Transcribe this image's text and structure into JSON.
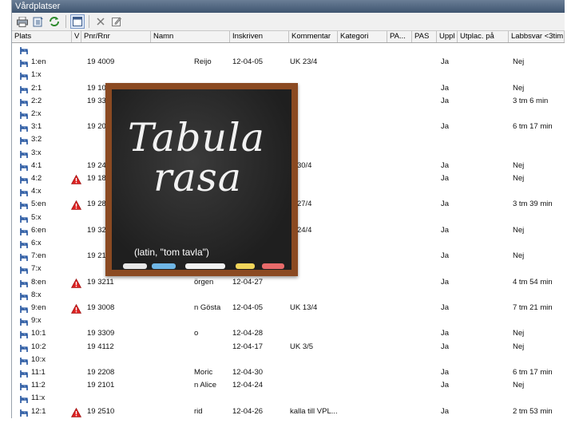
{
  "window": {
    "title": "Vårdplatser"
  },
  "toolbar": {
    "icons": [
      "printer-icon",
      "export-icon",
      "refresh-icon",
      "layout-icon",
      "delete-icon",
      "edit-icon"
    ]
  },
  "columns": {
    "plats": "Plats",
    "v": "V",
    "pnr": "Pnr/Rnr",
    "namn": "Namn",
    "inskriven": "Inskriven",
    "kommentar": "Kommentar",
    "kategori": "Kategori",
    "pa1": "PA...",
    "pa2": "PAS",
    "uppl": "Uppl",
    "utplac": "Utplac. på",
    "labbsvar": "Labbsvar <3tim"
  },
  "rows": [
    {
      "plats": "",
      "warn": false,
      "pnr": "",
      "namn": "",
      "inskriven": "",
      "kommentar": "",
      "uppl": "",
      "labb": ""
    },
    {
      "plats": "1:en",
      "warn": false,
      "pnr": "19 4009",
      "namn": "Reijo",
      "inskriven": "12-04-05",
      "kommentar": "UK 23/4",
      "uppl": "Ja",
      "labb": "Nej"
    },
    {
      "plats": "1:x",
      "warn": false,
      "pnr": "",
      "namn": "",
      "inskriven": "",
      "kommentar": "",
      "uppl": "",
      "labb": ""
    },
    {
      "plats": "2:1",
      "warn": false,
      "pnr": "19 10",
      "namn": "",
      "inskriven": "",
      "kommentar": "",
      "uppl": "Ja",
      "labb": "Nej"
    },
    {
      "plats": "2:2",
      "warn": false,
      "pnr": "19 33",
      "namn": "",
      "inskriven": "",
      "kommentar": "",
      "uppl": "Ja",
      "labb": "3 tm 6 min"
    },
    {
      "plats": "2:x",
      "warn": false,
      "pnr": "",
      "namn": "",
      "inskriven": "",
      "kommentar": "",
      "uppl": "",
      "labb": ""
    },
    {
      "plats": "3:1",
      "warn": false,
      "pnr": "19 20",
      "namn": "",
      "inskriven": "",
      "kommentar": "",
      "uppl": "Ja",
      "labb": "6 tm 17 min"
    },
    {
      "plats": "3:2",
      "warn": false,
      "pnr": "",
      "namn": "",
      "inskriven": "",
      "kommentar": "",
      "uppl": "",
      "labb": ""
    },
    {
      "plats": "3:x",
      "warn": false,
      "pnr": "",
      "namn": "",
      "inskriven": "",
      "kommentar": "",
      "uppl": "",
      "labb": ""
    },
    {
      "plats": "4:1",
      "warn": false,
      "pnr": "19 24",
      "namn": "",
      "inskriven": "",
      "kommentar": "K 30/4",
      "uppl": "Ja",
      "labb": "Nej"
    },
    {
      "plats": "4:2",
      "warn": true,
      "pnr": "19 18",
      "namn": "",
      "inskriven": "",
      "kommentar": "",
      "uppl": "Ja",
      "labb": "Nej"
    },
    {
      "plats": "4:x",
      "warn": false,
      "pnr": "",
      "namn": "",
      "inskriven": "",
      "kommentar": "",
      "uppl": "",
      "labb": ""
    },
    {
      "plats": "5:en",
      "warn": true,
      "pnr": "19 28",
      "namn": "",
      "inskriven": "",
      "kommentar": "K 27/4",
      "uppl": "Ja",
      "labb": "3 tm 39 min"
    },
    {
      "plats": "5:x",
      "warn": false,
      "pnr": "",
      "namn": "",
      "inskriven": "",
      "kommentar": "",
      "uppl": "",
      "labb": ""
    },
    {
      "plats": "6:en",
      "warn": false,
      "pnr": "19 32",
      "namn": "",
      "inskriven": "",
      "kommentar": "K 24/4",
      "uppl": "Ja",
      "labb": "Nej"
    },
    {
      "plats": "6:x",
      "warn": false,
      "pnr": "",
      "namn": "",
      "inskriven": "",
      "kommentar": "",
      "uppl": "",
      "labb": ""
    },
    {
      "plats": "7:en",
      "warn": false,
      "pnr": "19 21",
      "namn": "",
      "inskriven": "",
      "kommentar": "",
      "uppl": "Ja",
      "labb": "Nej"
    },
    {
      "plats": "7:x",
      "warn": false,
      "pnr": "",
      "namn": "",
      "inskriven": "",
      "kommentar": "",
      "uppl": "",
      "labb": ""
    },
    {
      "plats": "8:en",
      "warn": true,
      "pnr": "19 3211",
      "namn": "örgen",
      "inskriven": "12-04-27",
      "kommentar": "",
      "uppl": "Ja",
      "labb": "4 tm 54 min"
    },
    {
      "plats": "8:x",
      "warn": false,
      "pnr": "",
      "namn": "",
      "inskriven": "",
      "kommentar": "",
      "uppl": "",
      "labb": ""
    },
    {
      "plats": "9:en",
      "warn": true,
      "pnr": "19 3008",
      "namn": "n Gösta",
      "inskriven": "12-04-05",
      "kommentar": "UK 13/4",
      "uppl": "Ja",
      "labb": "7 tm 21 min"
    },
    {
      "plats": "9:x",
      "warn": false,
      "pnr": "",
      "namn": "",
      "inskriven": "",
      "kommentar": "",
      "uppl": "",
      "labb": ""
    },
    {
      "plats": "10:1",
      "warn": false,
      "pnr": "19 3309",
      "namn": "o",
      "inskriven": "12-04-28",
      "kommentar": "",
      "uppl": "Ja",
      "labb": "Nej"
    },
    {
      "plats": "10:2",
      "warn": false,
      "pnr": "19 4112",
      "namn": "",
      "inskriven": "12-04-17",
      "kommentar": "UK 3/5",
      "uppl": "Ja",
      "labb": "Nej"
    },
    {
      "plats": "10:x",
      "warn": false,
      "pnr": "",
      "namn": "",
      "inskriven": "",
      "kommentar": "",
      "uppl": "",
      "labb": ""
    },
    {
      "plats": "11:1",
      "warn": false,
      "pnr": "19 2208",
      "namn": "Moric",
      "inskriven": "12-04-30",
      "kommentar": "",
      "uppl": "Ja",
      "labb": "6 tm 17 min"
    },
    {
      "plats": "11:2",
      "warn": false,
      "pnr": "19 2101",
      "namn": "n Alice",
      "inskriven": "12-04-24",
      "kommentar": "",
      "uppl": "Ja",
      "labb": "Nej"
    },
    {
      "plats": "11:x",
      "warn": false,
      "pnr": "",
      "namn": "",
      "inskriven": "",
      "kommentar": "",
      "uppl": "",
      "labb": ""
    },
    {
      "plats": "12:1",
      "warn": true,
      "pnr": "19 2510",
      "namn": "rid",
      "inskriven": "12-04-26",
      "kommentar": "kalla till VPL...",
      "uppl": "Ja",
      "labb": "2 tm 53 min"
    }
  ],
  "overlay": {
    "title_line1": "Tabula",
    "title_line2": "rasa",
    "subtitle": "(latin, \"tom tavla\")"
  }
}
